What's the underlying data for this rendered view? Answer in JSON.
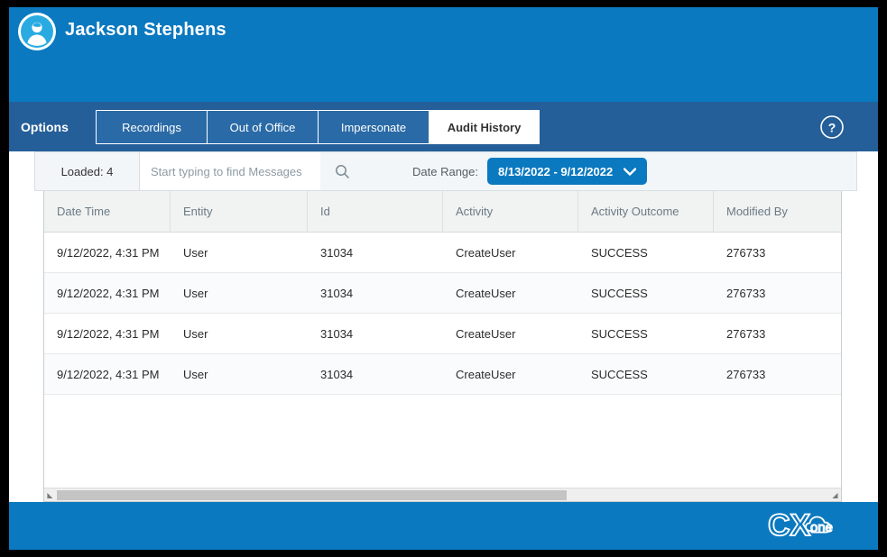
{
  "header": {
    "user_name": "Jackson Stephens",
    "avatar_icon": "user-avatar-icon",
    "bg_color": "#0b79bf"
  },
  "tab_bar": {
    "options_label": "Options",
    "bg_color": "#255f99",
    "help_icon": "help-circle-icon",
    "tabs": [
      {
        "label": "Recordings",
        "active": false
      },
      {
        "label": "Out of Office",
        "active": false
      },
      {
        "label": "Impersonate",
        "active": false
      },
      {
        "label": "Audit History",
        "active": true
      }
    ]
  },
  "toolbar": {
    "loaded_label": "Loaded: 4",
    "search_placeholder": "Start typing to find Messages",
    "search_value": "",
    "search_icon": "search-icon",
    "date_range_label": "Date Range:",
    "date_range_value": "8/13/2022 - 9/12/2022",
    "date_range_icon": "chevron-down-icon",
    "date_range_color": "#0b79bf"
  },
  "table": {
    "columns": [
      "Date Time",
      "Entity",
      "Id",
      "Activity",
      "Activity Outcome",
      "Modified By"
    ],
    "rows": [
      [
        "9/12/2022, 4:31 PM",
        "User",
        "31034",
        "CreateUser",
        "SUCCESS",
        "276733"
      ],
      [
        "9/12/2022, 4:31 PM",
        "User",
        "31034",
        "CreateUser",
        "SUCCESS",
        "276733"
      ],
      [
        "9/12/2022, 4:31 PM",
        "User",
        "31034",
        "CreateUser",
        "SUCCESS",
        "276733"
      ],
      [
        "9/12/2022, 4:31 PM",
        "User",
        "31034",
        "CreateUser",
        "SUCCESS",
        "276733"
      ]
    ],
    "scroll_left_icon": "scroll-left-arrow-icon",
    "scroll_right_icon": "scroll-right-arrow-icon"
  },
  "footer": {
    "logo_text_cx": "CX",
    "logo_text_one": "one",
    "bg_color": "#0b79bf"
  }
}
